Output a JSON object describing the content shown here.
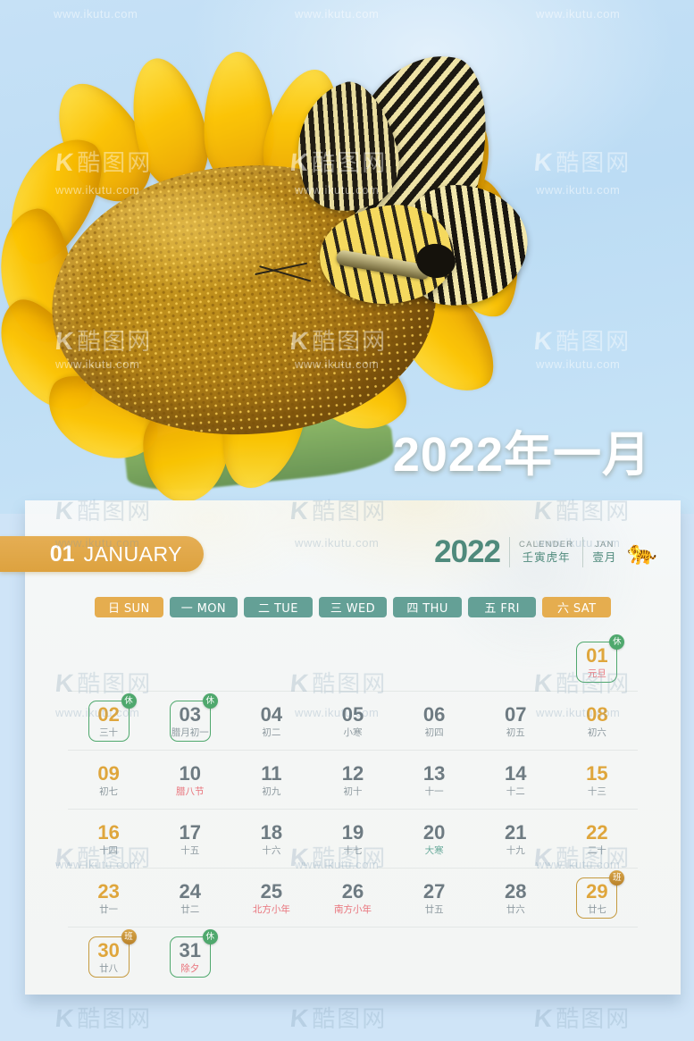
{
  "watermark": {
    "url": "www.ikutu.com",
    "logo_latin": "K",
    "logo_cn": "酷图网"
  },
  "hero": {
    "title": "2022年一月",
    "alt": "swallowtail-butterfly-on-sunflower"
  },
  "header": {
    "month_number": "01",
    "month_name": "JANUARY",
    "year": "2022",
    "calendar_label_en": "CALENDER",
    "calendar_label_cn": "壬寅虎年",
    "month_label_en": "JAN",
    "month_label_cn": "壹月",
    "zodiac_icon": "tiger-icon"
  },
  "weekdays": [
    {
      "label": "日 SUN",
      "type": "weekend"
    },
    {
      "label": "一 MON",
      "type": "weekday"
    },
    {
      "label": "二 TUE",
      "type": "weekday"
    },
    {
      "label": "三 WED",
      "type": "weekday"
    },
    {
      "label": "四 THU",
      "type": "weekday"
    },
    {
      "label": "五 FRI",
      "type": "weekday"
    },
    {
      "label": "六 SAT",
      "type": "weekend"
    }
  ],
  "colors": {
    "accent_orange": "#e5ad4f",
    "accent_teal": "#64a096",
    "rest_green": "#4fa86d",
    "work_gold": "#c59a3f",
    "festival_red": "#e9747c",
    "solar_term_green": "#6aab9b",
    "day_gray": "#6e7b82",
    "sky_blue": "#c6e1f6"
  },
  "badges": {
    "rest": "休",
    "work": "班"
  },
  "weeks": [
    [
      null,
      null,
      null,
      null,
      null,
      null,
      {
        "day": "01",
        "lunar": "元旦",
        "weekend": true,
        "lunar_style": "fest",
        "mark": "rest"
      }
    ],
    [
      {
        "day": "02",
        "lunar": "三十",
        "weekend": true,
        "lunar_style": "",
        "mark": "rest"
      },
      {
        "day": "03",
        "lunar": "腊月初一",
        "weekend": false,
        "lunar_style": "",
        "mark": "rest"
      },
      {
        "day": "04",
        "lunar": "初二",
        "weekend": false,
        "lunar_style": "",
        "mark": ""
      },
      {
        "day": "05",
        "lunar": "小寒",
        "weekend": false,
        "lunar_style": "",
        "mark": ""
      },
      {
        "day": "06",
        "lunar": "初四",
        "weekend": false,
        "lunar_style": "",
        "mark": ""
      },
      {
        "day": "07",
        "lunar": "初五",
        "weekend": false,
        "lunar_style": "",
        "mark": ""
      },
      {
        "day": "08",
        "lunar": "初六",
        "weekend": true,
        "lunar_style": "",
        "mark": ""
      }
    ],
    [
      {
        "day": "09",
        "lunar": "初七",
        "weekend": true,
        "lunar_style": "",
        "mark": ""
      },
      {
        "day": "10",
        "lunar": "腊八节",
        "weekend": false,
        "lunar_style": "fest",
        "mark": ""
      },
      {
        "day": "11",
        "lunar": "初九",
        "weekend": false,
        "lunar_style": "",
        "mark": ""
      },
      {
        "day": "12",
        "lunar": "初十",
        "weekend": false,
        "lunar_style": "",
        "mark": ""
      },
      {
        "day": "13",
        "lunar": "十一",
        "weekend": false,
        "lunar_style": "",
        "mark": ""
      },
      {
        "day": "14",
        "lunar": "十二",
        "weekend": false,
        "lunar_style": "",
        "mark": ""
      },
      {
        "day": "15",
        "lunar": "十三",
        "weekend": true,
        "lunar_style": "",
        "mark": ""
      }
    ],
    [
      {
        "day": "16",
        "lunar": "十四",
        "weekend": true,
        "lunar_style": "",
        "mark": ""
      },
      {
        "day": "17",
        "lunar": "十五",
        "weekend": false,
        "lunar_style": "",
        "mark": ""
      },
      {
        "day": "18",
        "lunar": "十六",
        "weekend": false,
        "lunar_style": "",
        "mark": ""
      },
      {
        "day": "19",
        "lunar": "十七",
        "weekend": false,
        "lunar_style": "",
        "mark": ""
      },
      {
        "day": "20",
        "lunar": "大寒",
        "weekend": false,
        "lunar_style": "term",
        "mark": ""
      },
      {
        "day": "21",
        "lunar": "十九",
        "weekend": false,
        "lunar_style": "",
        "mark": ""
      },
      {
        "day": "22",
        "lunar": "二十",
        "weekend": true,
        "lunar_style": "",
        "mark": ""
      }
    ],
    [
      {
        "day": "23",
        "lunar": "廿一",
        "weekend": true,
        "lunar_style": "",
        "mark": ""
      },
      {
        "day": "24",
        "lunar": "廿二",
        "weekend": false,
        "lunar_style": "",
        "mark": ""
      },
      {
        "day": "25",
        "lunar": "北方小年",
        "weekend": false,
        "lunar_style": "fest",
        "mark": ""
      },
      {
        "day": "26",
        "lunar": "南方小年",
        "weekend": false,
        "lunar_style": "fest",
        "mark": ""
      },
      {
        "day": "27",
        "lunar": "廿五",
        "weekend": false,
        "lunar_style": "",
        "mark": ""
      },
      {
        "day": "28",
        "lunar": "廿六",
        "weekend": false,
        "lunar_style": "",
        "mark": ""
      },
      {
        "day": "29",
        "lunar": "廿七",
        "weekend": true,
        "lunar_style": "",
        "mark": "work"
      }
    ],
    [
      {
        "day": "30",
        "lunar": "廿八",
        "weekend": true,
        "lunar_style": "",
        "mark": "work"
      },
      {
        "day": "31",
        "lunar": "除夕",
        "weekend": false,
        "lunar_style": "fest",
        "mark": "rest"
      },
      null,
      null,
      null,
      null,
      null
    ]
  ]
}
